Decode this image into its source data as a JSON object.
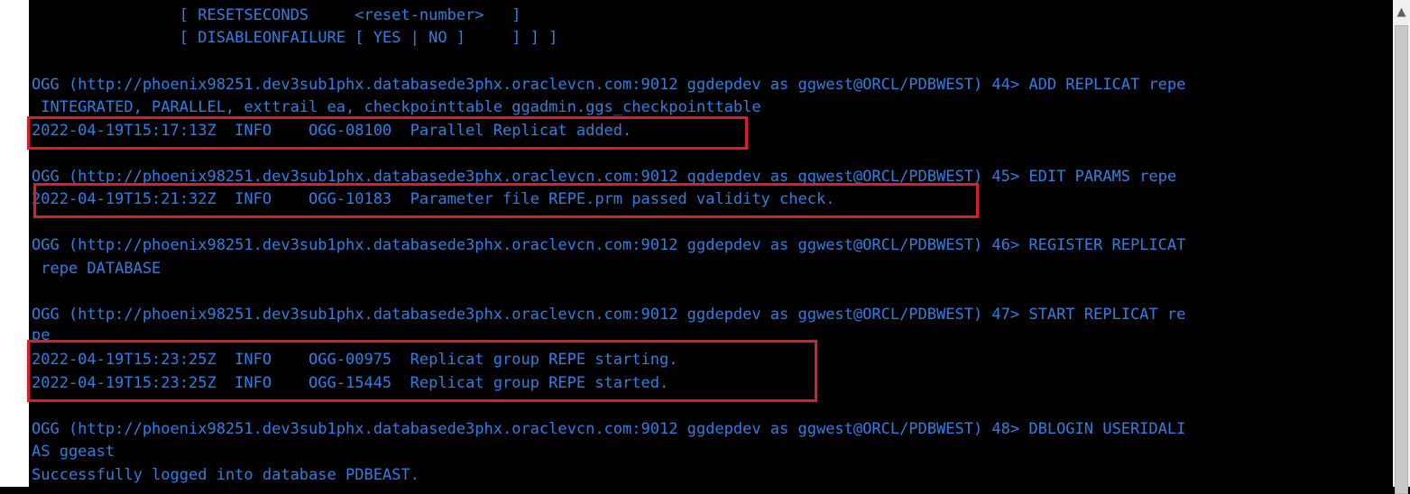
{
  "terminal": {
    "lines": [
      "                [ RESETSECONDS     <reset-number>   ]",
      "                [ DISABLEONFAILURE [ YES | NO ]     ] ] ]",
      "",
      "OGG (http://phoenix98251.dev3sub1phx.databasede3phx.oraclevcn.com:9012 ggdepdev as ggwest@ORCL/PDBWEST) 44> ADD REPLICAT repe",
      " INTEGRATED, PARALLEL, exttrail ea, checkpointtable ggadmin.ggs_checkpointtable",
      "2022-04-19T15:17:13Z  INFO    OGG-08100  Parallel Replicat added.",
      "",
      "OGG (http://phoenix98251.dev3sub1phx.databasede3phx.oraclevcn.com:9012 ggdepdev as ggwest@ORCL/PDBWEST) 45> EDIT PARAMS repe",
      "2022-04-19T15:21:32Z  INFO    OGG-10183  Parameter file REPE.prm passed validity check.",
      "",
      "OGG (http://phoenix98251.dev3sub1phx.databasede3phx.oraclevcn.com:9012 ggdepdev as ggwest@ORCL/PDBWEST) 46> REGISTER REPLICAT",
      " repe DATABASE",
      "",
      "OGG (http://phoenix98251.dev3sub1phx.databasede3phx.oraclevcn.com:9012 ggdepdev as ggwest@ORCL/PDBWEST) 47> START REPLICAT re",
      "pe",
      "2022-04-19T15:23:25Z  INFO    OGG-00975  Replicat group REPE starting.",
      "2022-04-19T15:23:25Z  INFO    OGG-15445  Replicat group REPE started.",
      "",
      "OGG (http://phoenix98251.dev3sub1phx.databasede3phx.oraclevcn.com:9012 ggdepdev as ggwest@ORCL/PDBWEST) 48> DBLOGIN USERIDALI",
      "AS ggeast",
      "Successfully logged into database PDBEAST."
    ]
  },
  "scrollbar": {
    "up_arrow_icon": "▲"
  },
  "colors": {
    "terminal_text": "#2f7fe3",
    "terminal_background": "#000000",
    "highlight_box": "#d8202a"
  }
}
